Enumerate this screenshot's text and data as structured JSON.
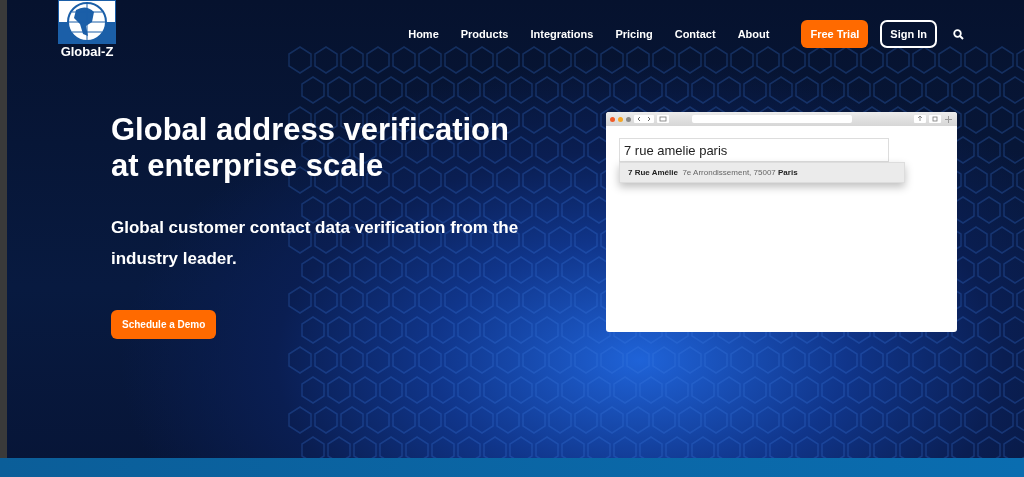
{
  "logo": {
    "text": "Global-Z"
  },
  "nav": {
    "items": [
      {
        "label": "Home"
      },
      {
        "label": "Products"
      },
      {
        "label": "Integrations"
      },
      {
        "label": "Pricing"
      },
      {
        "label": "Contact"
      },
      {
        "label": "About"
      }
    ],
    "free_trial": "Free Trial",
    "sign_in": "Sign In"
  },
  "hero": {
    "title": "Global address verification at enterprise scale",
    "subtitle": "Global customer contact data verification from the industry leader.",
    "cta": "Schedule a Demo"
  },
  "demo": {
    "input_value": "7 rue amelie paris",
    "suggestion": "**7 Rue Amélie**  7e Arrondissement, 75007 **Paris**"
  }
}
